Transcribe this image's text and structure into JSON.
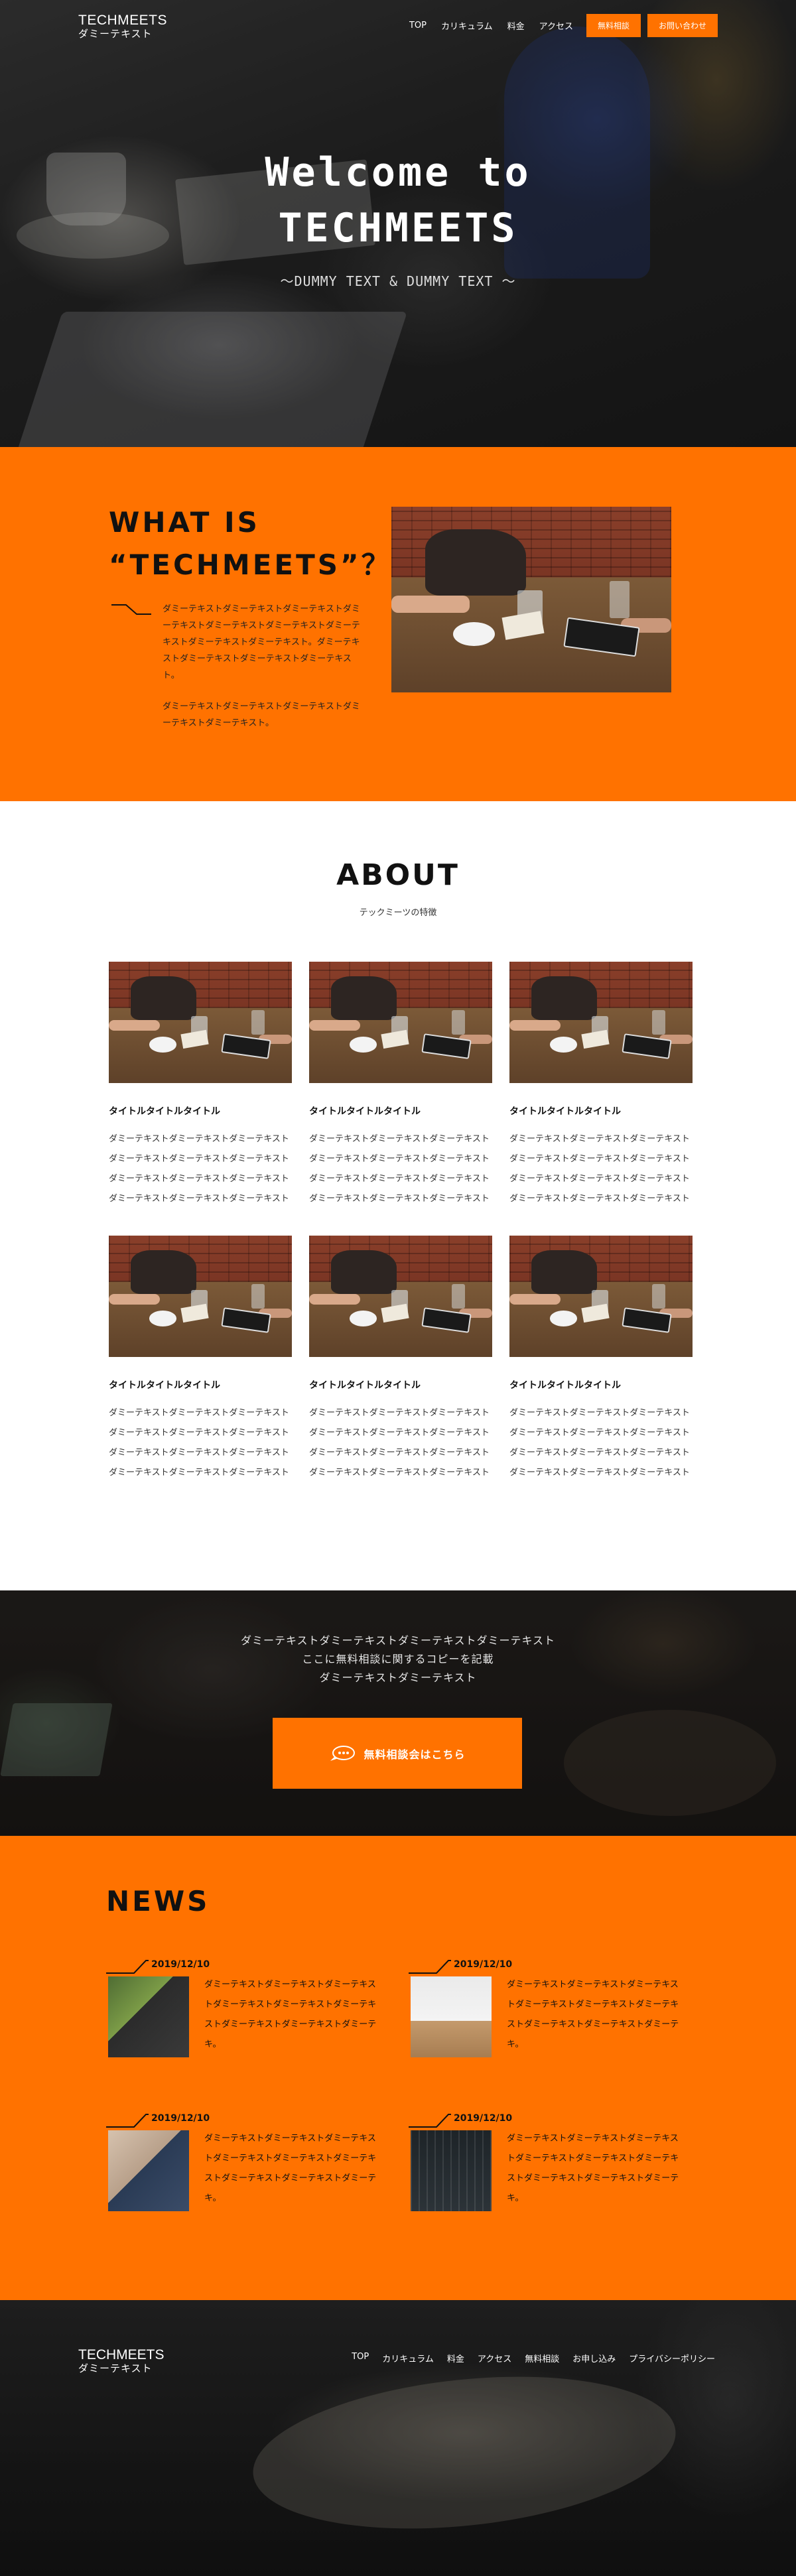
{
  "header": {
    "logo_line1": "TECHMEETS",
    "logo_line2": "ダミーテキスト",
    "nav": [
      "TOP",
      "カリキュラム",
      "料金",
      "アクセス"
    ],
    "cta_consult": "無料相談",
    "cta_contact": "お問い合わせ"
  },
  "hero": {
    "title": "Welcome to\nTECHMEETS",
    "subtitle": "～DUMMY TEXT & DUMMY TEXT ～"
  },
  "whatis": {
    "title": "WHAT IS\n“TECHMEETS”？",
    "paragraph1": "ダミーテキストダミーテキストダミーテキストダミーテキストダミーテキストダミーテキストダミーテキストダミーテキストダミーテキスト。ダミーテキストダミーテキストダミーテキストダミーテキスト。",
    "paragraph2": "ダミーテキストダミーテキストダミーテキストダミーテキストダミーテキスト。"
  },
  "about": {
    "title": "ABOUT",
    "subtitle": "テックミーツの特徴",
    "cards": [
      {
        "title": "タイトルタイトルタイトル",
        "text": "ダミーテキストダミーテキストダミーテキストダミーテキストダミーテキストダミーテキストダミーテキストダミーテキストダミーテキストダミーテキストダミーテキストダミーテキスト"
      },
      {
        "title": "タイトルタイトルタイトル",
        "text": "ダミーテキストダミーテキストダミーテキストダミーテキストダミーテキストダミーテキストダミーテキストダミーテキストダミーテキストダミーテキストダミーテキストダミーテキスト"
      },
      {
        "title": "タイトルタイトルタイトル",
        "text": "ダミーテキストダミーテキストダミーテキストダミーテキストダミーテキストダミーテキストダミーテキストダミーテキストダミーテキストダミーテキストダミーテキストダミーテキスト"
      },
      {
        "title": "タイトルタイトルタイトル",
        "text": "ダミーテキストダミーテキストダミーテキストダミーテキストダミーテキストダミーテキストダミーテキストダミーテキストダミーテキストダミーテキストダミーテキストダミーテキスト"
      },
      {
        "title": "タイトルタイトルタイトル",
        "text": "ダミーテキストダミーテキストダミーテキストダミーテキストダミーテキストダミーテキストダミーテキストダミーテキストダミーテキストダミーテキストダミーテキストダミーテキスト"
      },
      {
        "title": "タイトルタイトルタイトル",
        "text": "ダミーテキストダミーテキストダミーテキストダミーテキストダミーテキストダミーテキストダミーテキストダミーテキストダミーテキストダミーテキストダミーテキストダミーテキスト"
      }
    ]
  },
  "cta": {
    "text": "ダミーテキストダミーテキストダミーテキストダミーテキスト\nここに無料相談に関するコピーを記載\nダミーテキストダミーテキスト",
    "button": "無料相談会はこちら"
  },
  "news": {
    "title": "NEWS",
    "items": [
      {
        "date": "2019/12/10",
        "text": "ダミーテキストダミーテキストダミーテキストダミーテキストダミーテキストダミーテキストダミーテキストダミーテキストダミーテキ。",
        "thumb": "plant-photo"
      },
      {
        "date": "2019/12/10",
        "text": "ダミーテキストダミーテキストダミーテキストダミーテキストダミーテキストダミーテキストダミーテキストダミーテキストダミーテキ。",
        "thumb": "desk-photo"
      },
      {
        "date": "2019/12/10",
        "text": "ダミーテキストダミーテキストダミーテキストダミーテキストダミーテキストダミーテキストダミーテキストダミーテキストダミーテキ。",
        "thumb": "hands-photo"
      },
      {
        "date": "2019/12/10",
        "text": "ダミーテキストダミーテキストダミーテキストダミーテキストダミーテキストダミーテキストダミーテキストダミーテキストダミーテキ。",
        "thumb": "chart-photo"
      }
    ]
  },
  "footer": {
    "logo_line1": "TECHMEETS",
    "logo_line2": "ダミーテキスト",
    "nav": [
      "TOP",
      "カリキュラム",
      "料金",
      "アクセス",
      "無料相談",
      "お申し込み",
      "プライバシーポリシー"
    ]
  },
  "colors": {
    "accent": "#ff7200",
    "dark": "#111111",
    "white": "#ffffff"
  }
}
